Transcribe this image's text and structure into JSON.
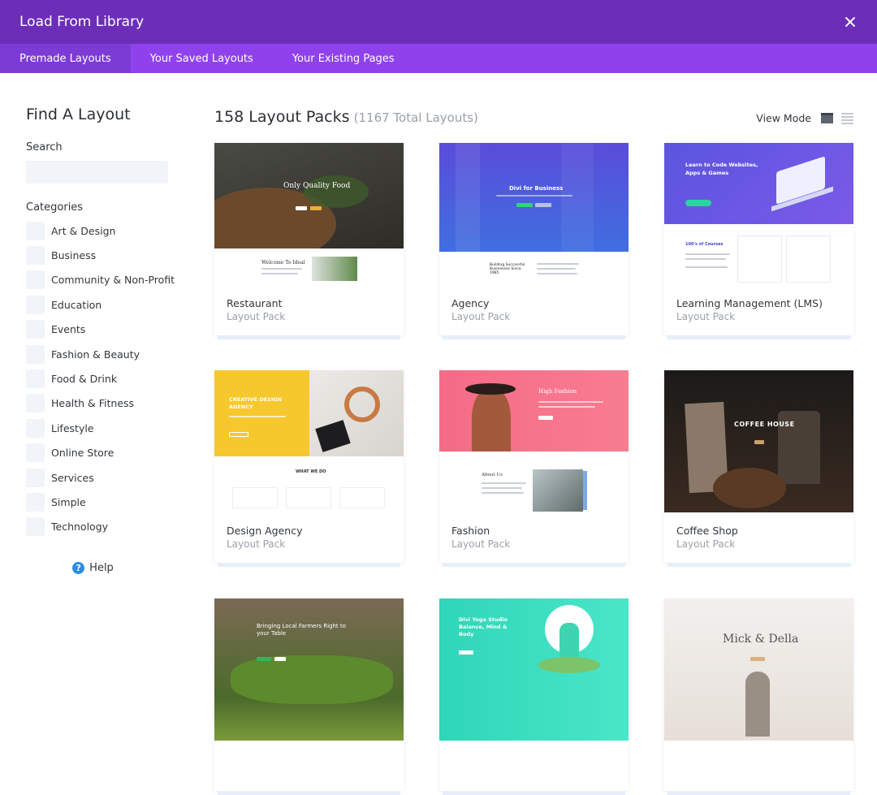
{
  "window": {
    "title": "Load From Library"
  },
  "tabs": [
    {
      "label": "Premade Layouts",
      "active": true
    },
    {
      "label": "Your Saved Layouts",
      "active": false
    },
    {
      "label": "Your Existing Pages",
      "active": false
    }
  ],
  "sidebar": {
    "heading": "Find A Layout",
    "search_label": "Search",
    "search_placeholder": "",
    "categories_label": "Categories",
    "categories": [
      "Art & Design",
      "Business",
      "Community & Non-Profit",
      "Education",
      "Events",
      "Fashion & Beauty",
      "Food & Drink",
      "Health & Fitness",
      "Lifestyle",
      "Online Store",
      "Services",
      "Simple",
      "Technology"
    ],
    "help_label": "Help"
  },
  "main": {
    "count_label": "158 Layout Packs",
    "total_label": "(1167 Total Layouts)",
    "view_mode_label": "View Mode"
  },
  "cards": [
    {
      "name": "Restaurant",
      "type": "Layout Pack",
      "thumb_text": "Only Quality Food",
      "thumb_text2": "Welcome To Ideal"
    },
    {
      "name": "Agency",
      "type": "Layout Pack",
      "thumb_text": "Divi for Business",
      "thumb_text2": "Building Successful Businesses Since 1985"
    },
    {
      "name": "Learning Management (LMS)",
      "type": "Layout Pack",
      "thumb_text": "Learn to Code Websites, Apps & Games",
      "thumb_text2": "100's of Courses"
    },
    {
      "name": "Design Agency",
      "type": "Layout Pack",
      "thumb_text": "CREATIVE DESIGN AGENCY",
      "thumb_text2": "WHAT WE DO"
    },
    {
      "name": "Fashion",
      "type": "Layout Pack",
      "thumb_text": "High Fashion",
      "thumb_text2": "About Us"
    },
    {
      "name": "Coffee Shop",
      "type": "Layout Pack",
      "thumb_text": "COFFEE HOUSE",
      "thumb_text2": ""
    },
    {
      "name": "",
      "type": "",
      "thumb_text": "Bringing Local Farmers Right to your Table",
      "thumb_text2": ""
    },
    {
      "name": "",
      "type": "",
      "thumb_text": "Divi Yoga Studio Balance, Mind & Body",
      "thumb_text2": ""
    },
    {
      "name": "",
      "type": "",
      "thumb_text": "Mick & Della",
      "thumb_text2": ""
    }
  ]
}
